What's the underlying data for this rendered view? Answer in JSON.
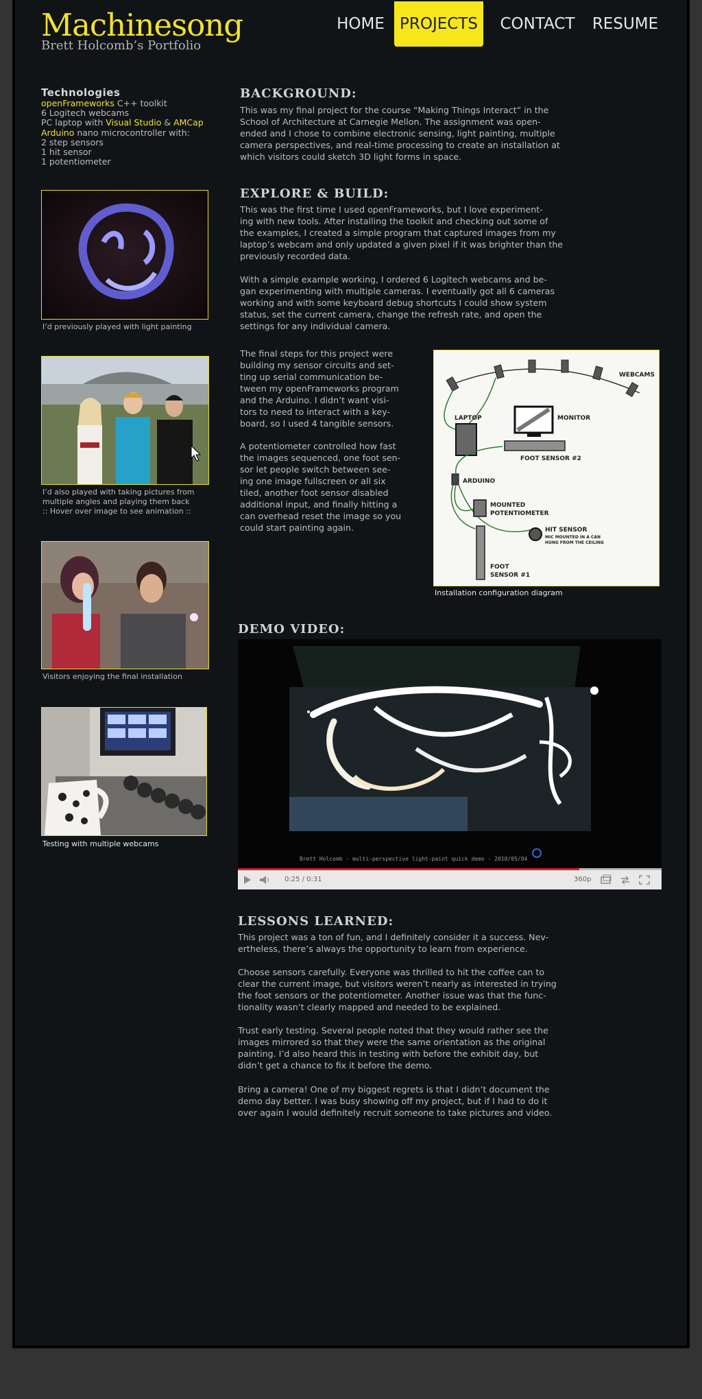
{
  "header": {
    "logo_title": "Machinesong",
    "logo_subtitle": "Brett Holcomb’s Portfolio",
    "nav": [
      {
        "label": "HOME"
      },
      {
        "label": "PROJECTS",
        "active": true
      },
      {
        "label": "CONTACT"
      },
      {
        "label": "RESUME"
      }
    ]
  },
  "sidebar": {
    "technologies_heading": "Technologies",
    "tech": {
      "line1_link": "openFrameworks",
      "line1_rest": " C++ toolkit",
      "line2": "6 Logitech webcams",
      "line3_pre": "PC laptop with ",
      "line3_link1": "Visual Studio",
      "line3_mid": " & ",
      "line3_link2": "AMCap",
      "line4_link": "Arduino",
      "line4_rest": " nano microcontroller with:",
      "line5": "2 step sensors",
      "line6": "1 hit sensor",
      "line7": "1 potentiometer"
    },
    "images": [
      {
        "caption": "I’d previously played with light painting"
      },
      {
        "caption_line1": "I’d also played with taking pictures from",
        "caption_line2": "multiple angles and playing them back",
        "caption_line3": ":: Hover over image to see animation ::"
      },
      {
        "caption": "Visitors enjoying the final installation"
      },
      {
        "caption": "Testing with multiple webcams"
      }
    ]
  },
  "main": {
    "background": {
      "heading": "BACKGROUND:",
      "lines": [
        "This was my final project for the course “Making Things Interact” in the",
        "School of Architecture at Carnegie Mellon. The assignment was open-",
        "ended and I chose to combine electronic sensing, light painting, multiple",
        "camera perspectives, and real-time processing to create an installation at",
        "which visitors could sketch 3D light forms in space."
      ]
    },
    "explore": {
      "heading": "EXPLORE & BUILD:",
      "p1": [
        "This was the first time I used openFrameworks, but I love experiment-",
        "ing with new tools. After installing the toolkit and checking out some of",
        "the examples, I created a simple program that captured images from my",
        "laptop’s webcam and only updated a given pixel if it was brighter than the",
        "previously recorded data."
      ],
      "p2": [
        "With a simple example working, I ordered 6 Logitech webcams and be-",
        "gan experimenting with multiple cameras. I eventually got all 6 cameras",
        "working and with some keyboard debug shortcuts I could show system",
        "status, set the current camera, change the refresh rate, and open the",
        "settings for any individual camera."
      ],
      "p3": [
        "The final steps for this project were",
        "building my sensor circuits and set-",
        "ting up serial communication be-",
        "tween my openFrameworks program",
        "and the Arduino. I didn’t want visi-",
        "tors to need to interact with a key-",
        "board, so I used 4 tangible sensors."
      ],
      "p4": [
        "A potentiometer controlled how fast",
        "the images sequenced, one foot sen-",
        "sor let people switch between see-",
        "ing one image fullscreen or all six",
        "tiled, another foot sensor disabled",
        "additional input, and finally hitting a",
        "can overhead reset the image so you",
        "could start painting again."
      ]
    },
    "diagram": {
      "caption": "Installation configuration diagram",
      "labels": {
        "webcams": "WEBCAMS",
        "laptop": "LAPTOP",
        "monitor": "MONITOR",
        "foot2": "FOOT SENSOR #2",
        "arduino": "ARDUINO",
        "mounted": "MOUNTED",
        "potentiometer": "POTENTIOMETER",
        "hit": "HIT SENSOR",
        "hit_note1": "MIC MOUNTED IN A CAN",
        "hit_note2": "HUNG FROM THE CEILING",
        "foot": "FOOT",
        "sensor1": "SENSOR #1"
      }
    },
    "demo": {
      "heading": "DEMO VIDEO:",
      "overlay": "Brett Holcomb - multi-perspective light-paint quick demo - 2010/05/04",
      "time": "0:25 / 0:31",
      "quality": "360p",
      "progress": 0.806
    },
    "lessons": {
      "heading": "LESSONS LEARNED:",
      "p1": [
        "This project was a ton of fun, and I definitely consider it a success. Nev-",
        "ertheless, there’s always the opportunity to learn from experience."
      ],
      "p2": [
        "Choose sensors carefully. Everyone was thrilled to hit the coffee can to",
        "clear the current image, but visitors weren’t nearly as interested in trying",
        "the foot sensors or the potentiometer. Another issue was that the func-",
        "tionality wasn’t clearly mapped and needed to be explained."
      ],
      "p3": [
        "Trust early testing. Several people noted that they would rather see the",
        "images mirrored so that they were the same orientation as the original",
        "painting. I’d also heard this in testing with before the exhibit day, but",
        "didn’t get a chance to fix it before the demo."
      ],
      "p4": [
        "Bring a camera! One of my biggest regrets is that I didn’t document the",
        "demo day better. I was busy showing off my project, but if I had to do it",
        "over again I would definitely recruit someone to take pictures and video."
      ]
    }
  },
  "colors": {
    "accent_yellow": "#f2e12e",
    "page_bg": "#101417",
    "outer_bg": "#333333"
  }
}
